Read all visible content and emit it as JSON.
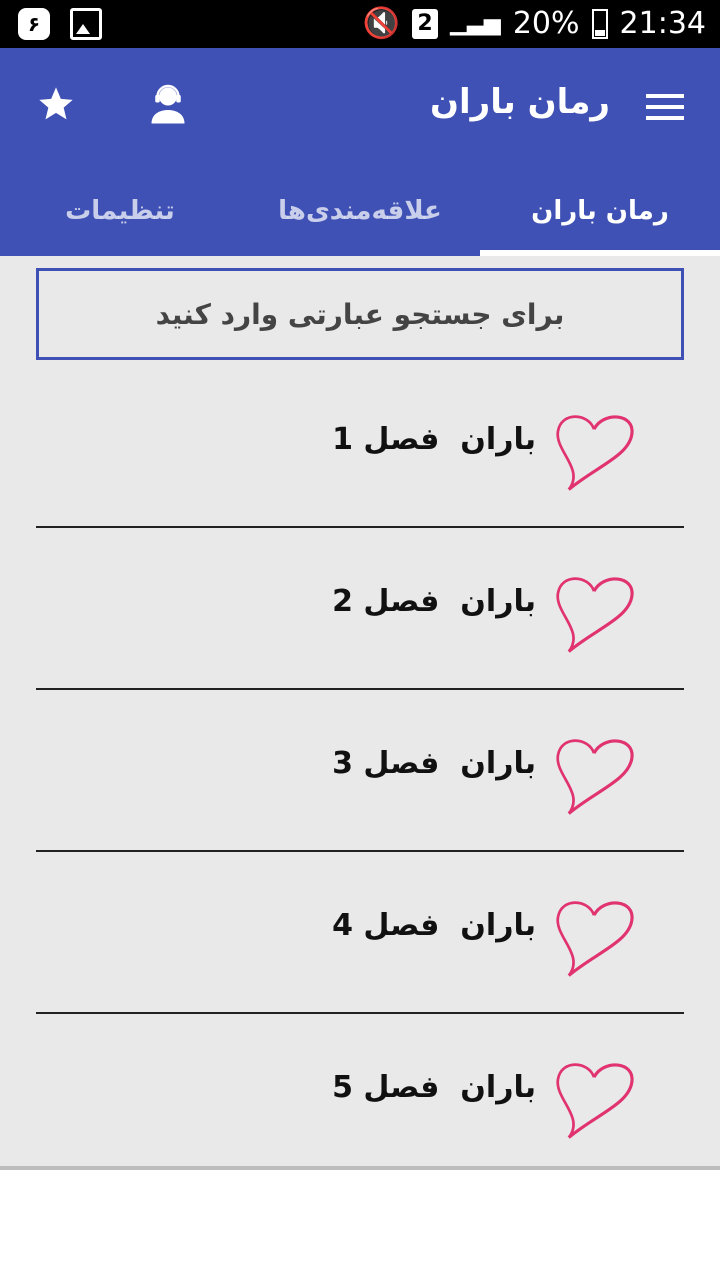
{
  "status_bar": {
    "left_badge": "۶",
    "battery": "20%",
    "time": "21:34",
    "sim": "2"
  },
  "app": {
    "title": "رمان باران"
  },
  "tabs": [
    {
      "label": "رمان باران",
      "active": true
    },
    {
      "label": "علاقه‌مندی‌ها",
      "active": false
    },
    {
      "label": "تنظیمات",
      "active": false
    }
  ],
  "search": {
    "placeholder": "برای جستجو عبارتی وارد کنید"
  },
  "chapters": [
    {
      "label": "باران  فصل 1"
    },
    {
      "label": "باران  فصل 2"
    },
    {
      "label": "باران  فصل 3"
    },
    {
      "label": "باران  فصل 4"
    },
    {
      "label": "باران  فصل 5"
    }
  ],
  "colors": {
    "primary": "#3f51b5",
    "heart": "#e0336f",
    "background": "#e9e9e9"
  }
}
